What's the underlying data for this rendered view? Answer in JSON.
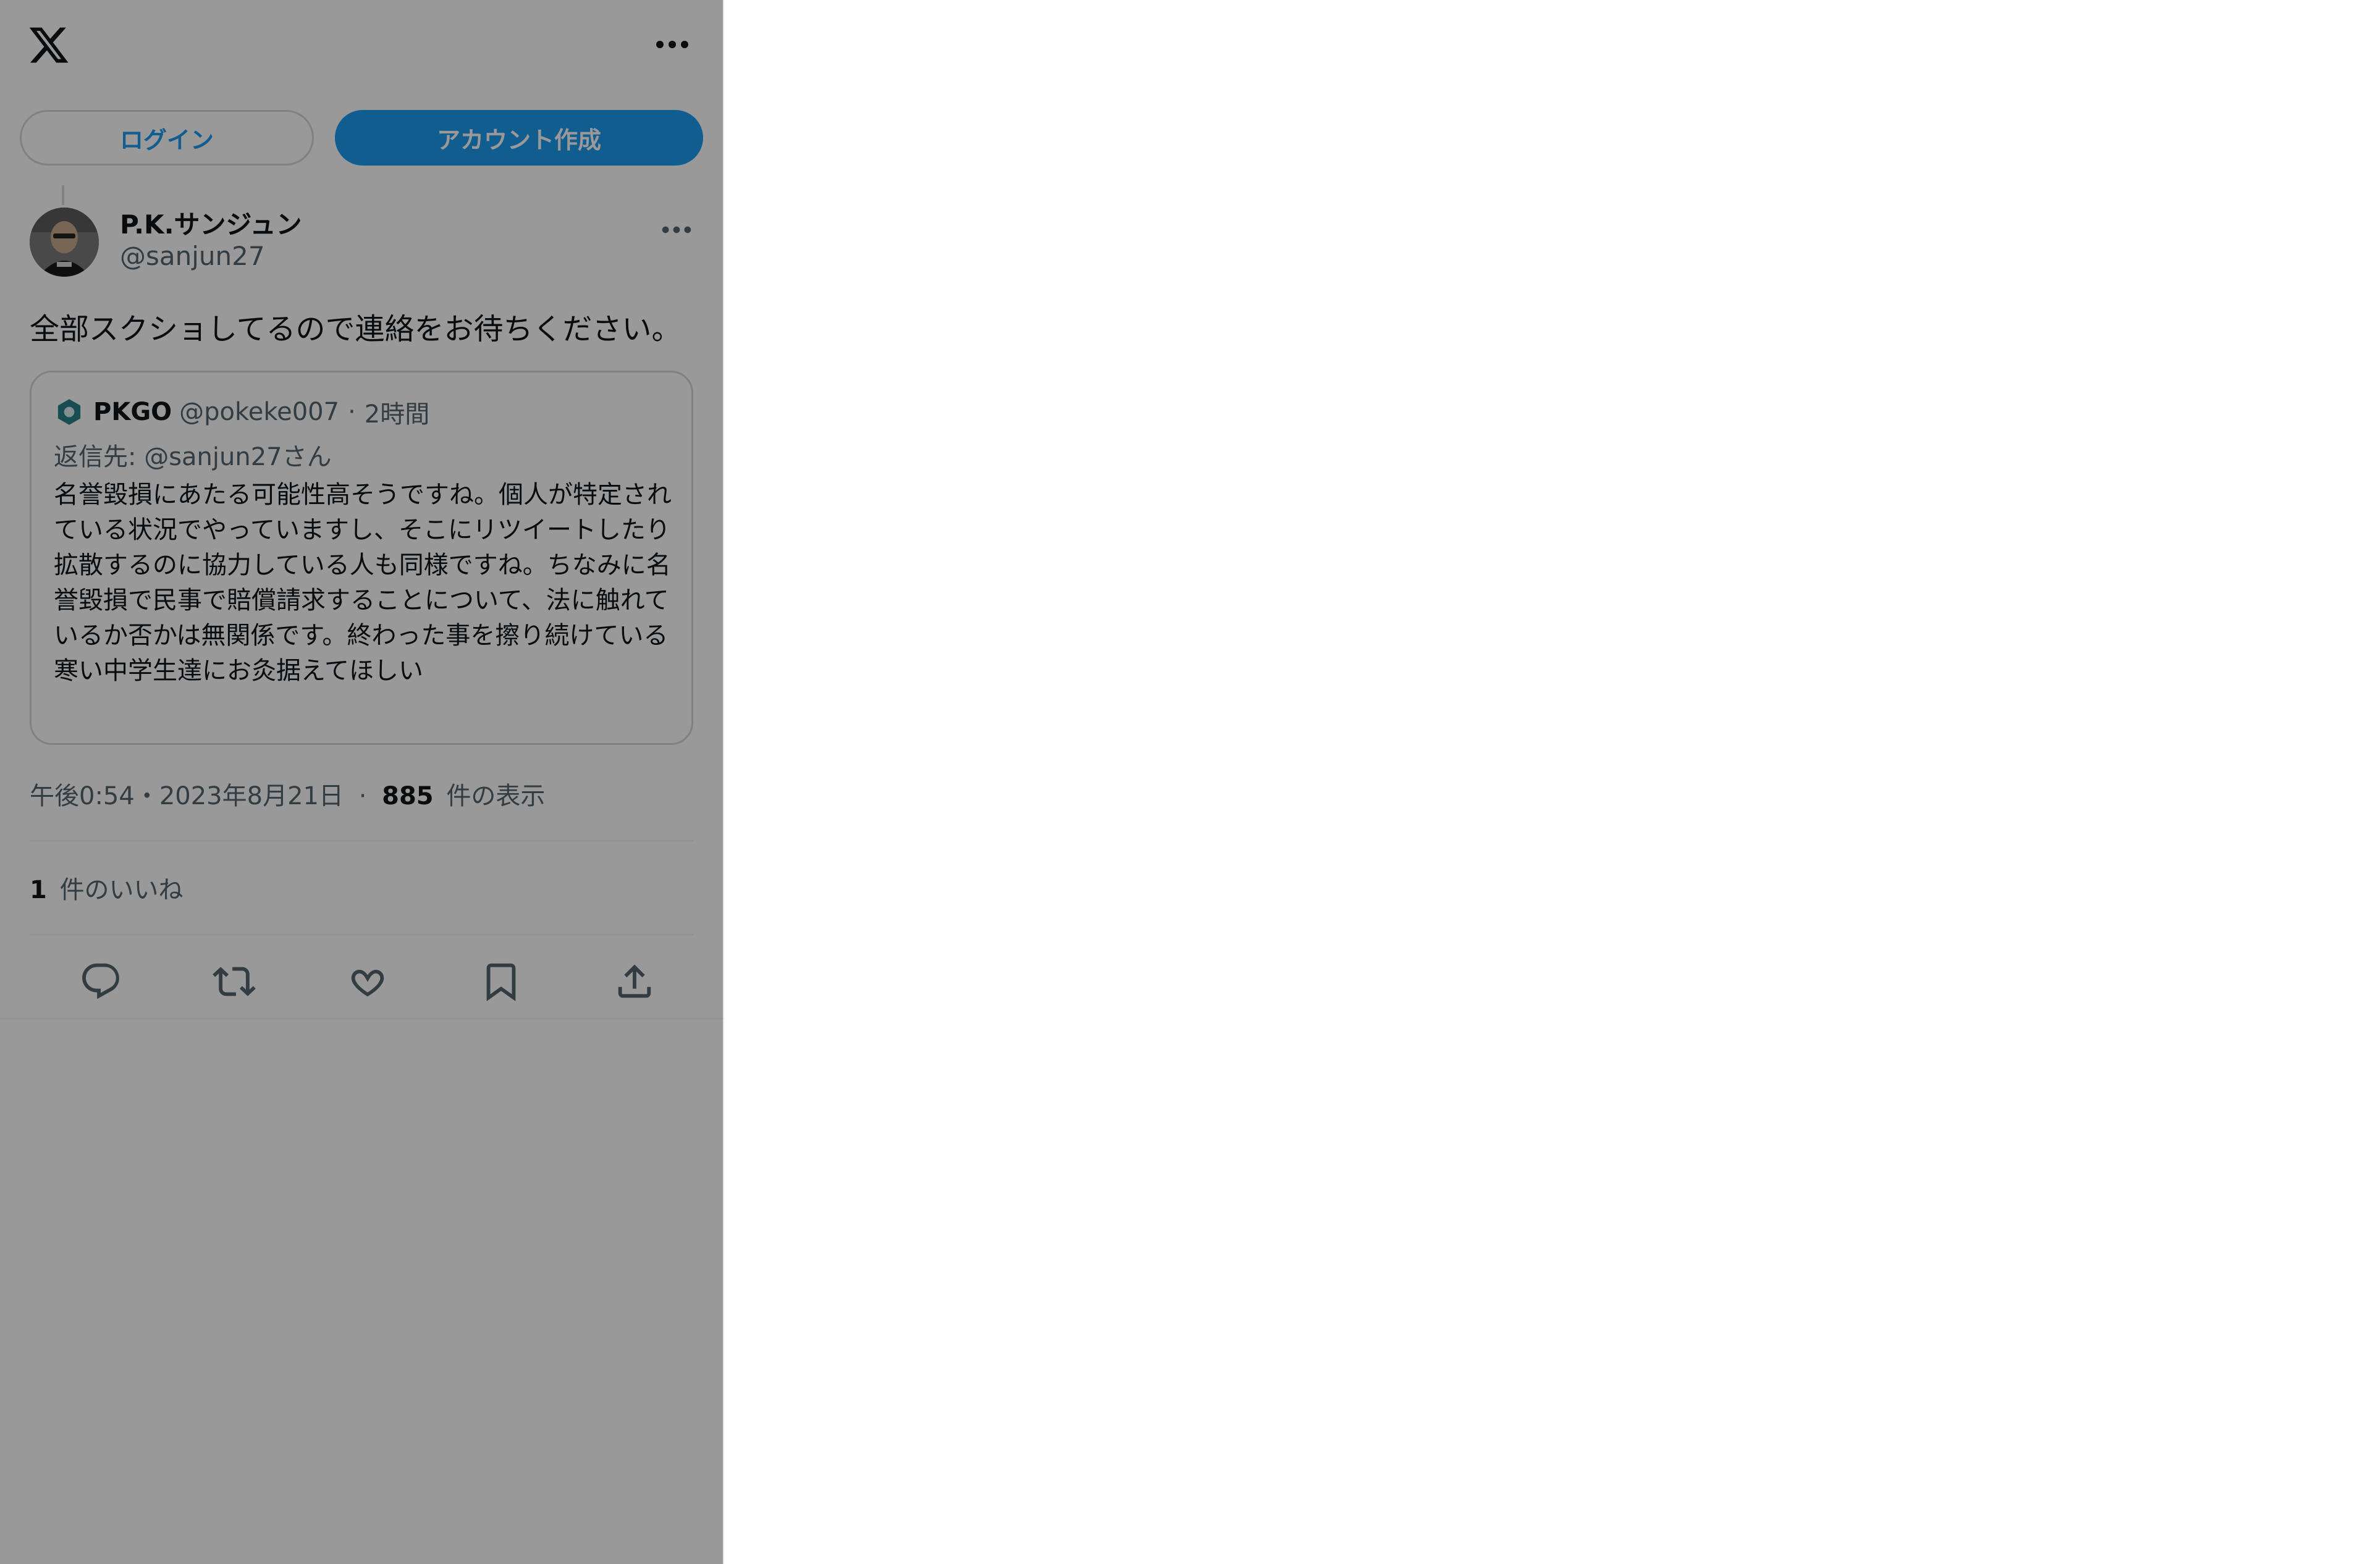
{
  "header": {
    "logo_icon": "x-logo-icon",
    "more_icon": "more-horizontal-icon"
  },
  "auth": {
    "login_label": "ログイン",
    "signup_label": "アカウント作成"
  },
  "tweet": {
    "author_name": "P.K.サンジュン",
    "author_handle": "@sanjun27",
    "text": "全部スクショしてるので連絡をお待ちください。",
    "quote": {
      "name": "PKGO",
      "handle": "@pokeke007",
      "separator": "·",
      "time": "2時間",
      "reply_to": "返信先: @sanjun27さん",
      "body": "名誉毀損にあたる可能性高そうですね。個人が特定されている状況でやっていますし、そこにリツイートしたり拡散するのに協力している人も同様ですね。ちなみに名誉毀損で民事で賠償請求することについて、法に触れているか否かは無関係です。終わった事を擦り続けている寒い中学生達にお灸据えてほしい"
    },
    "timestamp": "午後0:54・2023年8月21日",
    "separator": "·",
    "views_count": "885",
    "views_label": "件の表示",
    "likes_count": "1",
    "likes_label": "件のいいね"
  },
  "actions": {
    "reply_icon": "reply-icon",
    "retweet_icon": "retweet-icon",
    "like_icon": "heart-icon",
    "bookmark_icon": "bookmark-icon",
    "share_icon": "share-icon"
  },
  "colors": {
    "accent": "#1d9bf0",
    "text_primary": "#0f1419",
    "text_secondary": "#536471",
    "border": "#cfd9de",
    "overlay": "rgba(0,0,0,0.4)"
  }
}
